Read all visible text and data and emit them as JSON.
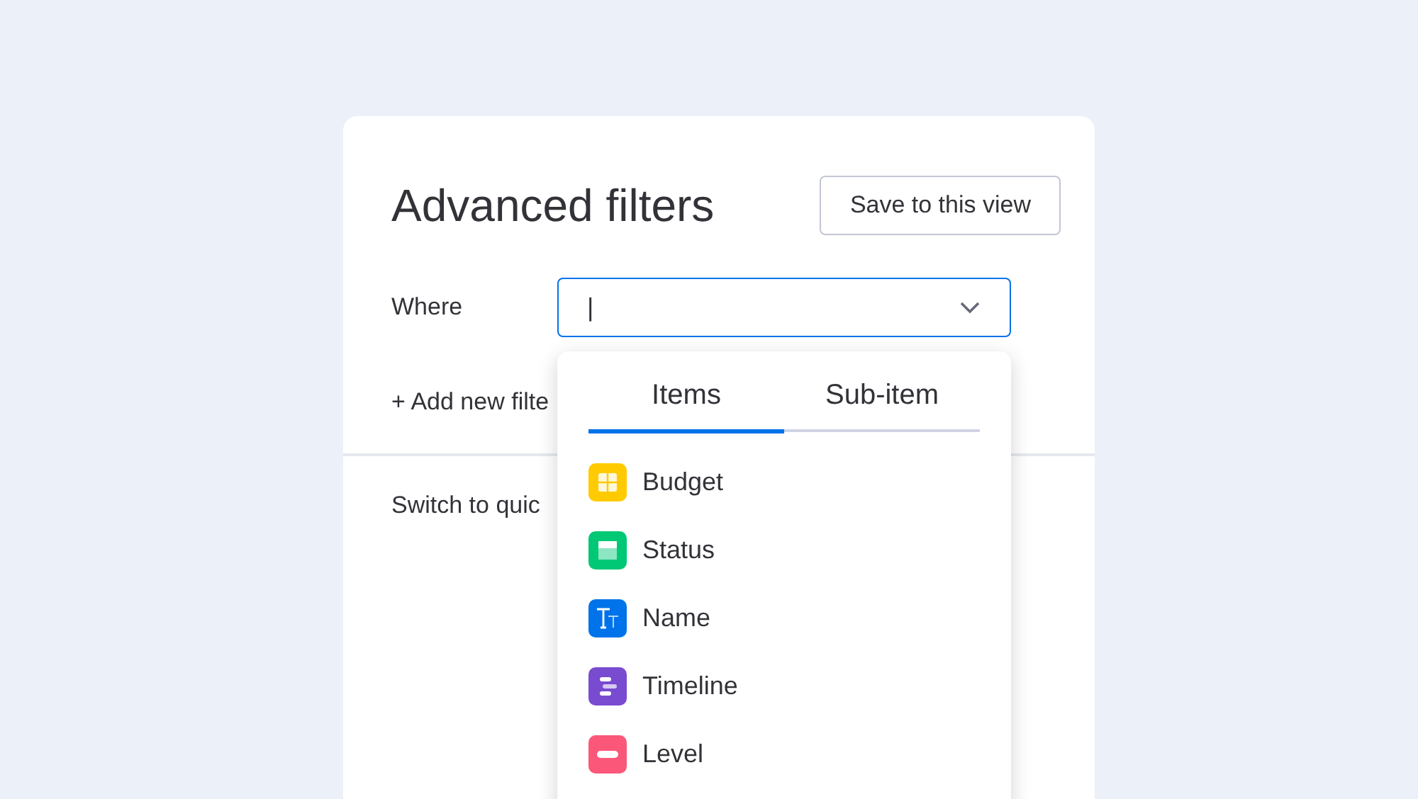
{
  "panel": {
    "title": "Advanced filters",
    "save_button": "Save to this view",
    "where_label": "Where",
    "where_field": {
      "value": "|"
    },
    "add_filter": "+ Add new filte",
    "switch_link": "Switch to quic"
  },
  "dropdown": {
    "tabs": [
      {
        "label": "Items",
        "selected": true
      },
      {
        "label": "Sub-item",
        "selected": false
      }
    ],
    "items": [
      {
        "label": "Budget",
        "kind": "numbers",
        "color": "#ffcb00"
      },
      {
        "label": "Status",
        "kind": "status",
        "color": "#00c875"
      },
      {
        "label": "Name",
        "kind": "text",
        "color": "#0073ea"
      },
      {
        "label": "Timeline",
        "kind": "timeline",
        "color": "#784bd1"
      },
      {
        "label": "Level",
        "kind": "rating",
        "color": "#fb5779"
      }
    ]
  }
}
